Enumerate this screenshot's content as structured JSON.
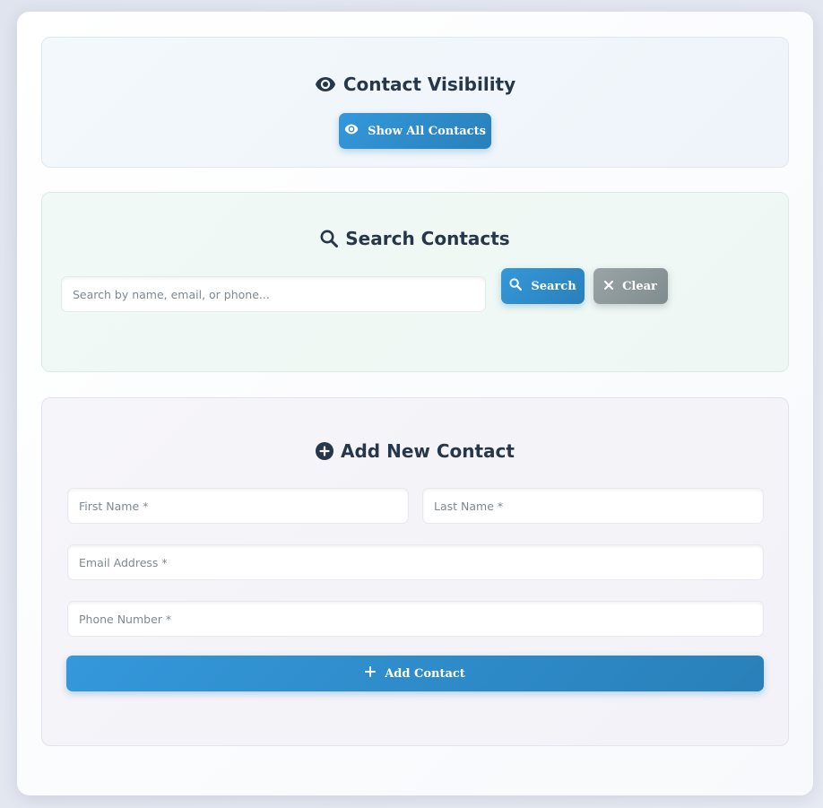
{
  "visibility": {
    "title": "Contact Visibility",
    "button_label": "Show All Contacts"
  },
  "search": {
    "title": "Search Contacts",
    "placeholder": "Search by name, email, or phone...",
    "search_label": "Search",
    "clear_label": "Clear"
  },
  "add_contact": {
    "title": "Add New Contact",
    "first_name_placeholder": "First Name *",
    "last_name_placeholder": "Last Name *",
    "email_placeholder": "Email Address *",
    "phone_placeholder": "Phone Number *",
    "submit_label": "Add Contact"
  },
  "colors": {
    "primary": "#3498db",
    "primary_dark": "#2980b9",
    "secondary": "#7f8c8d",
    "heading": "#26374a"
  }
}
